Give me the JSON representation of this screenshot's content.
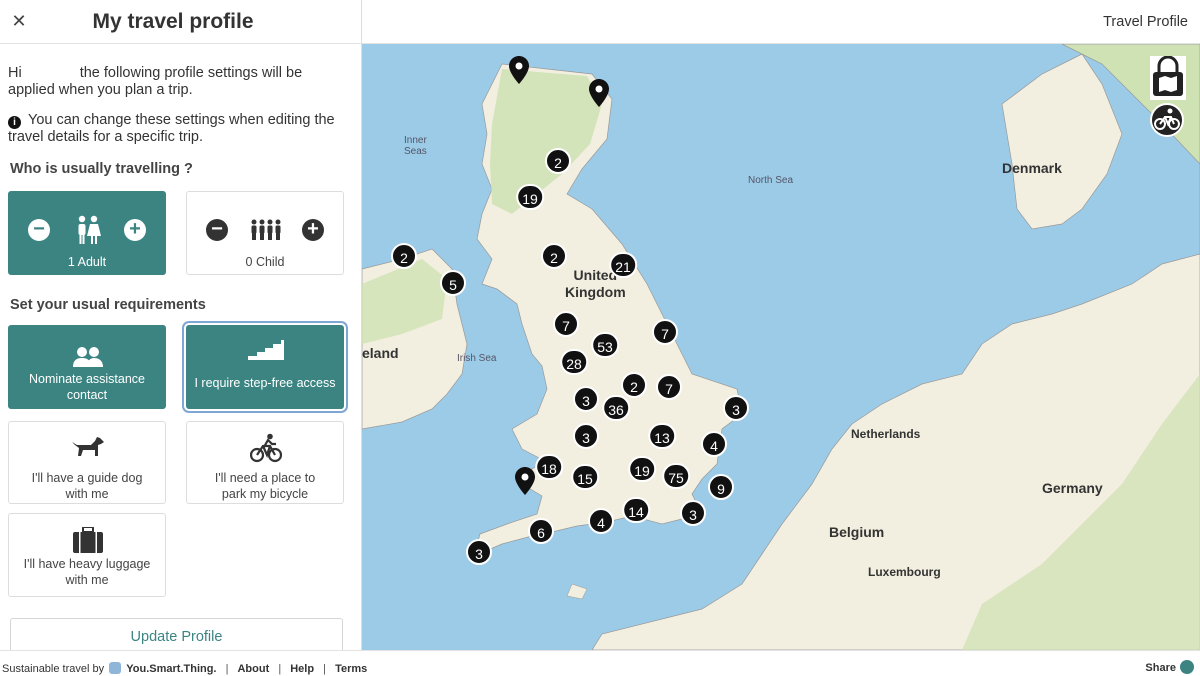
{
  "panel": {
    "title": "My travel profile",
    "close_icon": "close-icon",
    "greeting_hi": "Hi",
    "greeting_rest": "the following profile settings will be applied when you plan a trip.",
    "info_text": "You can change these settings when editing the travel details for a specific trip.",
    "who_title": "Who is usually travelling ?",
    "travellers": [
      {
        "label": "1 Adult",
        "icon": "adults-icon",
        "selected": true
      },
      {
        "label": "0 Child",
        "icon": "children-icon",
        "selected": false
      }
    ],
    "req_title": "Set your usual requirements",
    "requirements": [
      {
        "label": "Nominate assistance contact",
        "icon": "contact-icon",
        "selected": true
      },
      {
        "label": "I require step-free access",
        "icon": "stairs-icon",
        "selected": true
      },
      {
        "label": "I'll have a guide dog with me",
        "icon": "dog-icon",
        "selected": false
      },
      {
        "label": "I'll need a place to park my bicycle",
        "icon": "bicycle-icon",
        "selected": false
      },
      {
        "label": "I'll have heavy luggage with me",
        "icon": "luggage-icon",
        "selected": false
      }
    ],
    "update_label": "Update Profile"
  },
  "topbar": {
    "title": "Travel Profile"
  },
  "map": {
    "labels": {
      "inner_seas": "Inner\nSeas",
      "north_sea": "North Sea",
      "denmark": "Denmark",
      "uk": "United\nKingdom",
      "ireland": "eland",
      "irish_sea": "Irish Sea",
      "netherlands": "Netherlands",
      "germany": "Germany",
      "belgium": "Belgium",
      "luxembourg": "Luxembourg"
    },
    "clusters": [
      "2",
      "19",
      "2",
      "2",
      "21",
      "5",
      "7",
      "7",
      "53",
      "28",
      "2",
      "7",
      "3",
      "36",
      "3",
      "3",
      "13",
      "4",
      "18",
      "19",
      "75",
      "15",
      "9",
      "14",
      "4",
      "3",
      "6",
      "3"
    ],
    "controls": [
      "lock-map-icon",
      "bicycle-map-icon"
    ]
  },
  "footer": {
    "prefix": "Sustainable travel by",
    "brand": "You.Smart.Thing.",
    "links": [
      "About",
      "Help",
      "Terms"
    ],
    "share": "Share"
  },
  "colors": {
    "accent": "#3b8482",
    "sea": "#9ccbe8",
    "land": "#f2efe0",
    "green": "#cfe2b3"
  }
}
